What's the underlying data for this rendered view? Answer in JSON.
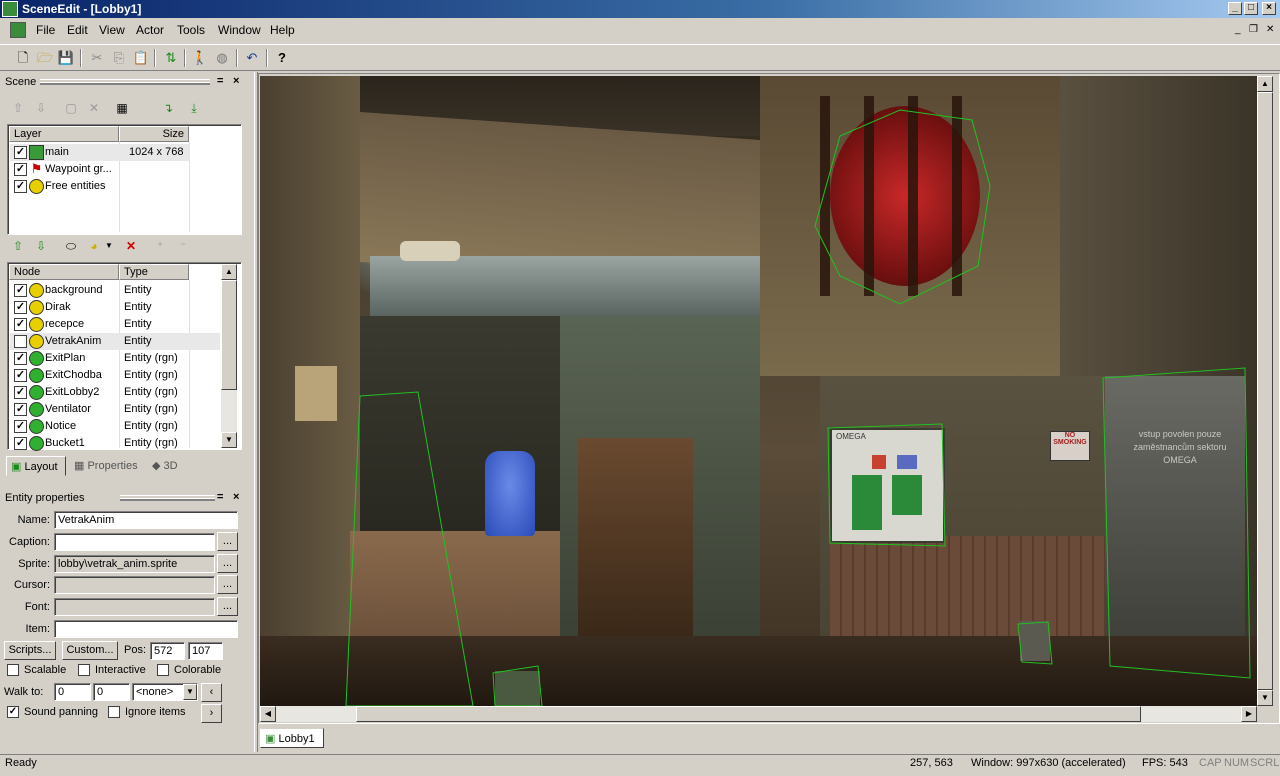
{
  "window": {
    "title": "SceneEdit - [Lobby1]"
  },
  "menu": [
    "File",
    "Edit",
    "View",
    "Actor",
    "Tools",
    "Window",
    "Help"
  ],
  "scene_panel": {
    "title": "Scene",
    "layer_header": "Layer",
    "size_header": "Size",
    "layers": [
      {
        "name": "main",
        "size": "1024 x 768",
        "checked": true,
        "icon": "layer-icon"
      },
      {
        "name": "Waypoint gr...",
        "size": "",
        "checked": true,
        "icon": "waypoint-flag-icon"
      },
      {
        "name": "Free entities",
        "size": "",
        "checked": true,
        "icon": "entity-icon"
      }
    ],
    "node_header": "Node",
    "type_header": "Type",
    "nodes": [
      {
        "name": "background",
        "type": "Entity",
        "checked": true,
        "icon": "entity-icon"
      },
      {
        "name": "Dirak",
        "type": "Entity",
        "checked": true,
        "icon": "entity-icon"
      },
      {
        "name": "recepce",
        "type": "Entity",
        "checked": true,
        "icon": "entity-icon"
      },
      {
        "name": "VetrakAnim",
        "type": "Entity",
        "checked": false,
        "icon": "entity-icon"
      },
      {
        "name": "ExitPlan",
        "type": "Entity (rgn)",
        "checked": true,
        "icon": "region-entity-icon"
      },
      {
        "name": "ExitChodba",
        "type": "Entity (rgn)",
        "checked": true,
        "icon": "region-entity-icon"
      },
      {
        "name": "ExitLobby2",
        "type": "Entity (rgn)",
        "checked": true,
        "icon": "region-entity-icon"
      },
      {
        "name": "Ventilator",
        "type": "Entity (rgn)",
        "checked": true,
        "icon": "region-entity-icon"
      },
      {
        "name": "Notice",
        "type": "Entity (rgn)",
        "checked": true,
        "icon": "region-entity-icon"
      },
      {
        "name": "Bucket1",
        "type": "Entity (rgn)",
        "checked": true,
        "icon": "region-entity-icon"
      }
    ],
    "tabs": [
      "Layout",
      "Properties",
      "3D"
    ]
  },
  "entity_props": {
    "title": "Entity properties",
    "name_label": "Name:",
    "name_value": "VetrakAnim",
    "caption_label": "Caption:",
    "caption_value": "",
    "sprite_label": "Sprite:",
    "sprite_value": "lobby\\vetrak_anim.sprite",
    "cursor_label": "Cursor:",
    "font_label": "Font:",
    "item_label": "Item:",
    "browse_label": "...",
    "scripts_label": "Scripts...",
    "custom_label": "Custom...",
    "pos_label": "Pos:",
    "pos_x": "572",
    "pos_y": "107",
    "scalable_label": "Scalable",
    "interactive_label": "Interactive",
    "colorable_label": "Colorable",
    "walkto_label": "Walk to:",
    "walk_x": "0",
    "walk_y": "0",
    "walk_dir": "<none>",
    "sound_panning_label": "Sound panning",
    "ignore_items_label": "Ignore items",
    "sound_panning": true
  },
  "doc_tab": "Lobby1",
  "status": {
    "text": "Ready",
    "coords": "257, 563",
    "window_info": "Window: 997x630 (accelerated)",
    "fps": "FPS: 543",
    "cap": "CAP",
    "num": "NUM",
    "scrl": "SCRL"
  },
  "scene_text": {
    "omega_sign": "OMEGA",
    "nosmoking": "NO SMOKING",
    "door_sign": "vstup povolen pouze zaměstnancům sektoru OMEGA"
  }
}
